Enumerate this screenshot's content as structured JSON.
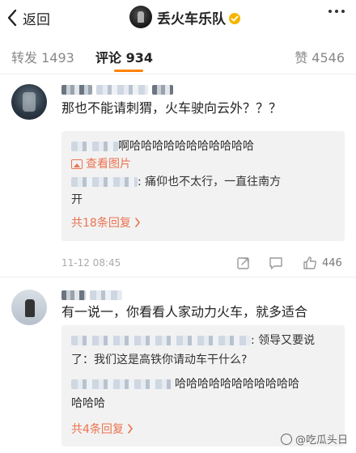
{
  "header": {
    "back_label": "返回",
    "title": "丢火车乐队",
    "verified_color": "#f7b500"
  },
  "tabs": {
    "repost": "转发 1493",
    "comment": "评论 934",
    "like": "赞 4546",
    "active_color": "#ff8200"
  },
  "comments": [
    {
      "text": "那也不能请刺猬，火车驶向云外？？？",
      "replies": [
        {
          "text": "啊哈哈哈哈哈哈哈哈哈哈哈"
        },
        {
          "link": "查看图片"
        },
        {
          "text": ": 痛仰也不太行，一直往南方"
        },
        {
          "text": "开"
        }
      ],
      "more_replies": "共18条回复",
      "time": "11-12 08:45",
      "likes": "446"
    },
    {
      "text": "有一说一，你看看人家动力火车，就多适合",
      "replies": [
        {
          "text": ": 领导又要说"
        },
        {
          "text": "了：我们这是高铁你请动车干什么?"
        },
        {
          "text": "哈哈哈哈哈哈哈哈哈哈哈"
        },
        {
          "text": "哈哈哈"
        }
      ],
      "more_replies": "共4条回复"
    }
  ],
  "watermark": "@吃瓜头日",
  "accent_link_color": "#eb7350"
}
